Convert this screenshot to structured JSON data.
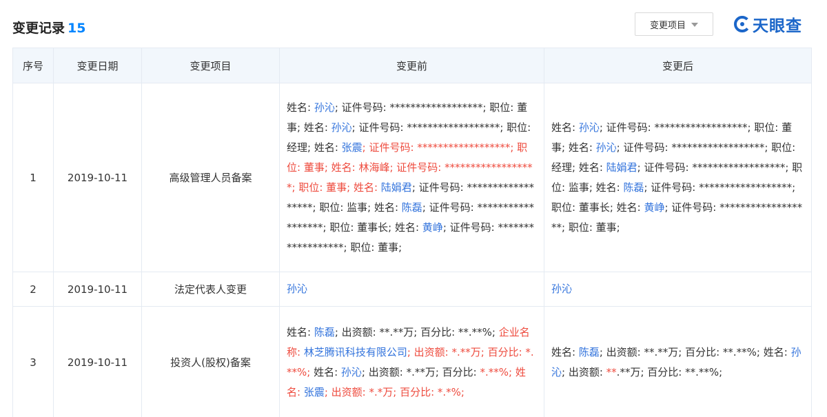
{
  "header": {
    "title": "变更记录",
    "count": "15",
    "filter_label": "变更项目",
    "logo_text": "天眼查"
  },
  "table": {
    "columns": [
      "序号",
      "变更日期",
      "变更项目",
      "变更前",
      "变更后"
    ],
    "rows": [
      {
        "index": "1",
        "date": "2019-10-11",
        "item": "高级管理人员备案",
        "before": [
          {
            "t": "姓名: ",
            "c": ""
          },
          {
            "t": "孙沁",
            "c": "blue"
          },
          {
            "t": "; 证件号码: ******************; 职位: 董事; 姓名: ",
            "c": ""
          },
          {
            "t": "孙沁",
            "c": "blue"
          },
          {
            "t": "; 证件号码: ******************; 职位: 经理; 姓名: ",
            "c": ""
          },
          {
            "t": "张震",
            "c": "blue"
          },
          {
            "t": "; 证件号码: ******************; 职位: 董事; 姓名: 林海峰; 证件号码: ******************; 职位: 董事; 姓名: ",
            "c": "red"
          },
          {
            "t": "陆娟君",
            "c": "blue"
          },
          {
            "t": "; 证件号码: ******************; 职位: 监事; 姓名: ",
            "c": ""
          },
          {
            "t": "陈磊",
            "c": "blue"
          },
          {
            "t": "; 证件号码: ******************; 职位: 董事长; 姓名: ",
            "c": ""
          },
          {
            "t": "黄峥",
            "c": "blue"
          },
          {
            "t": "; 证件号码: ******************; 职位: 董事;",
            "c": ""
          }
        ],
        "after": [
          {
            "t": "姓名: ",
            "c": ""
          },
          {
            "t": "孙沁",
            "c": "blue"
          },
          {
            "t": "; 证件号码: ******************; 职位: 董事; 姓名: ",
            "c": ""
          },
          {
            "t": "孙沁",
            "c": "blue"
          },
          {
            "t": "; 证件号码: ******************; 职位: 经理; 姓名: ",
            "c": ""
          },
          {
            "t": "陆娟君",
            "c": "blue"
          },
          {
            "t": "; 证件号码: ******************; 职位: 监事; 姓名: ",
            "c": ""
          },
          {
            "t": "陈磊",
            "c": "blue"
          },
          {
            "t": "; 证件号码: ******************; 职位: 董事长; 姓名: ",
            "c": ""
          },
          {
            "t": "黄峥",
            "c": "blue"
          },
          {
            "t": "; 证件号码: ******************; 职位: 董事;",
            "c": ""
          }
        ]
      },
      {
        "index": "2",
        "date": "2019-10-11",
        "item": "法定代表人变更",
        "before": [
          {
            "t": "孙沁",
            "c": "blue"
          }
        ],
        "after": [
          {
            "t": "孙沁",
            "c": "blue"
          }
        ]
      },
      {
        "index": "3",
        "date": "2019-10-11",
        "item": "投资人(股权)备案",
        "before": [
          {
            "t": "姓名: ",
            "c": ""
          },
          {
            "t": "陈磊",
            "c": "blue"
          },
          {
            "t": "; 出资额: **.**万; 百分比: **.**%; ",
            "c": ""
          },
          {
            "t": "企业名称: ",
            "c": "red"
          },
          {
            "t": "林芝腾讯科技有限公司",
            "c": "blue"
          },
          {
            "t": "; 出资额: *.**万; 百分比: *.**%;",
            "c": "red"
          },
          {
            "t": " 姓名: ",
            "c": ""
          },
          {
            "t": "孙沁",
            "c": "blue"
          },
          {
            "t": "; 出资额: *.**万; 百分比: ",
            "c": ""
          },
          {
            "t": "*.**%; 姓名: ",
            "c": "red"
          },
          {
            "t": "张震",
            "c": "blue"
          },
          {
            "t": "; 出资额: *.*万; 百分比: *.*%;",
            "c": "red"
          }
        ],
        "after": [
          {
            "t": "姓名: ",
            "c": ""
          },
          {
            "t": "陈磊",
            "c": "blue"
          },
          {
            "t": "; 出资额: **.**万; 百分比: **.**%; 姓名: ",
            "c": ""
          },
          {
            "t": "孙沁",
            "c": "blue"
          },
          {
            "t": "; 出资额: ",
            "c": ""
          },
          {
            "t": "**",
            "c": "red"
          },
          {
            "t": ".**万; 百分比: **.**%;",
            "c": ""
          }
        ]
      }
    ]
  },
  "colors": {
    "accent": "#0084ff",
    "link": "#3273dc",
    "changed": "#ee4b3e",
    "header_bg": "#f2f7fc",
    "border": "#e4eaf2"
  },
  "icons": {
    "filter_caret": "caret-down-icon",
    "logo_mark": "tianyancha-logo-icon"
  }
}
